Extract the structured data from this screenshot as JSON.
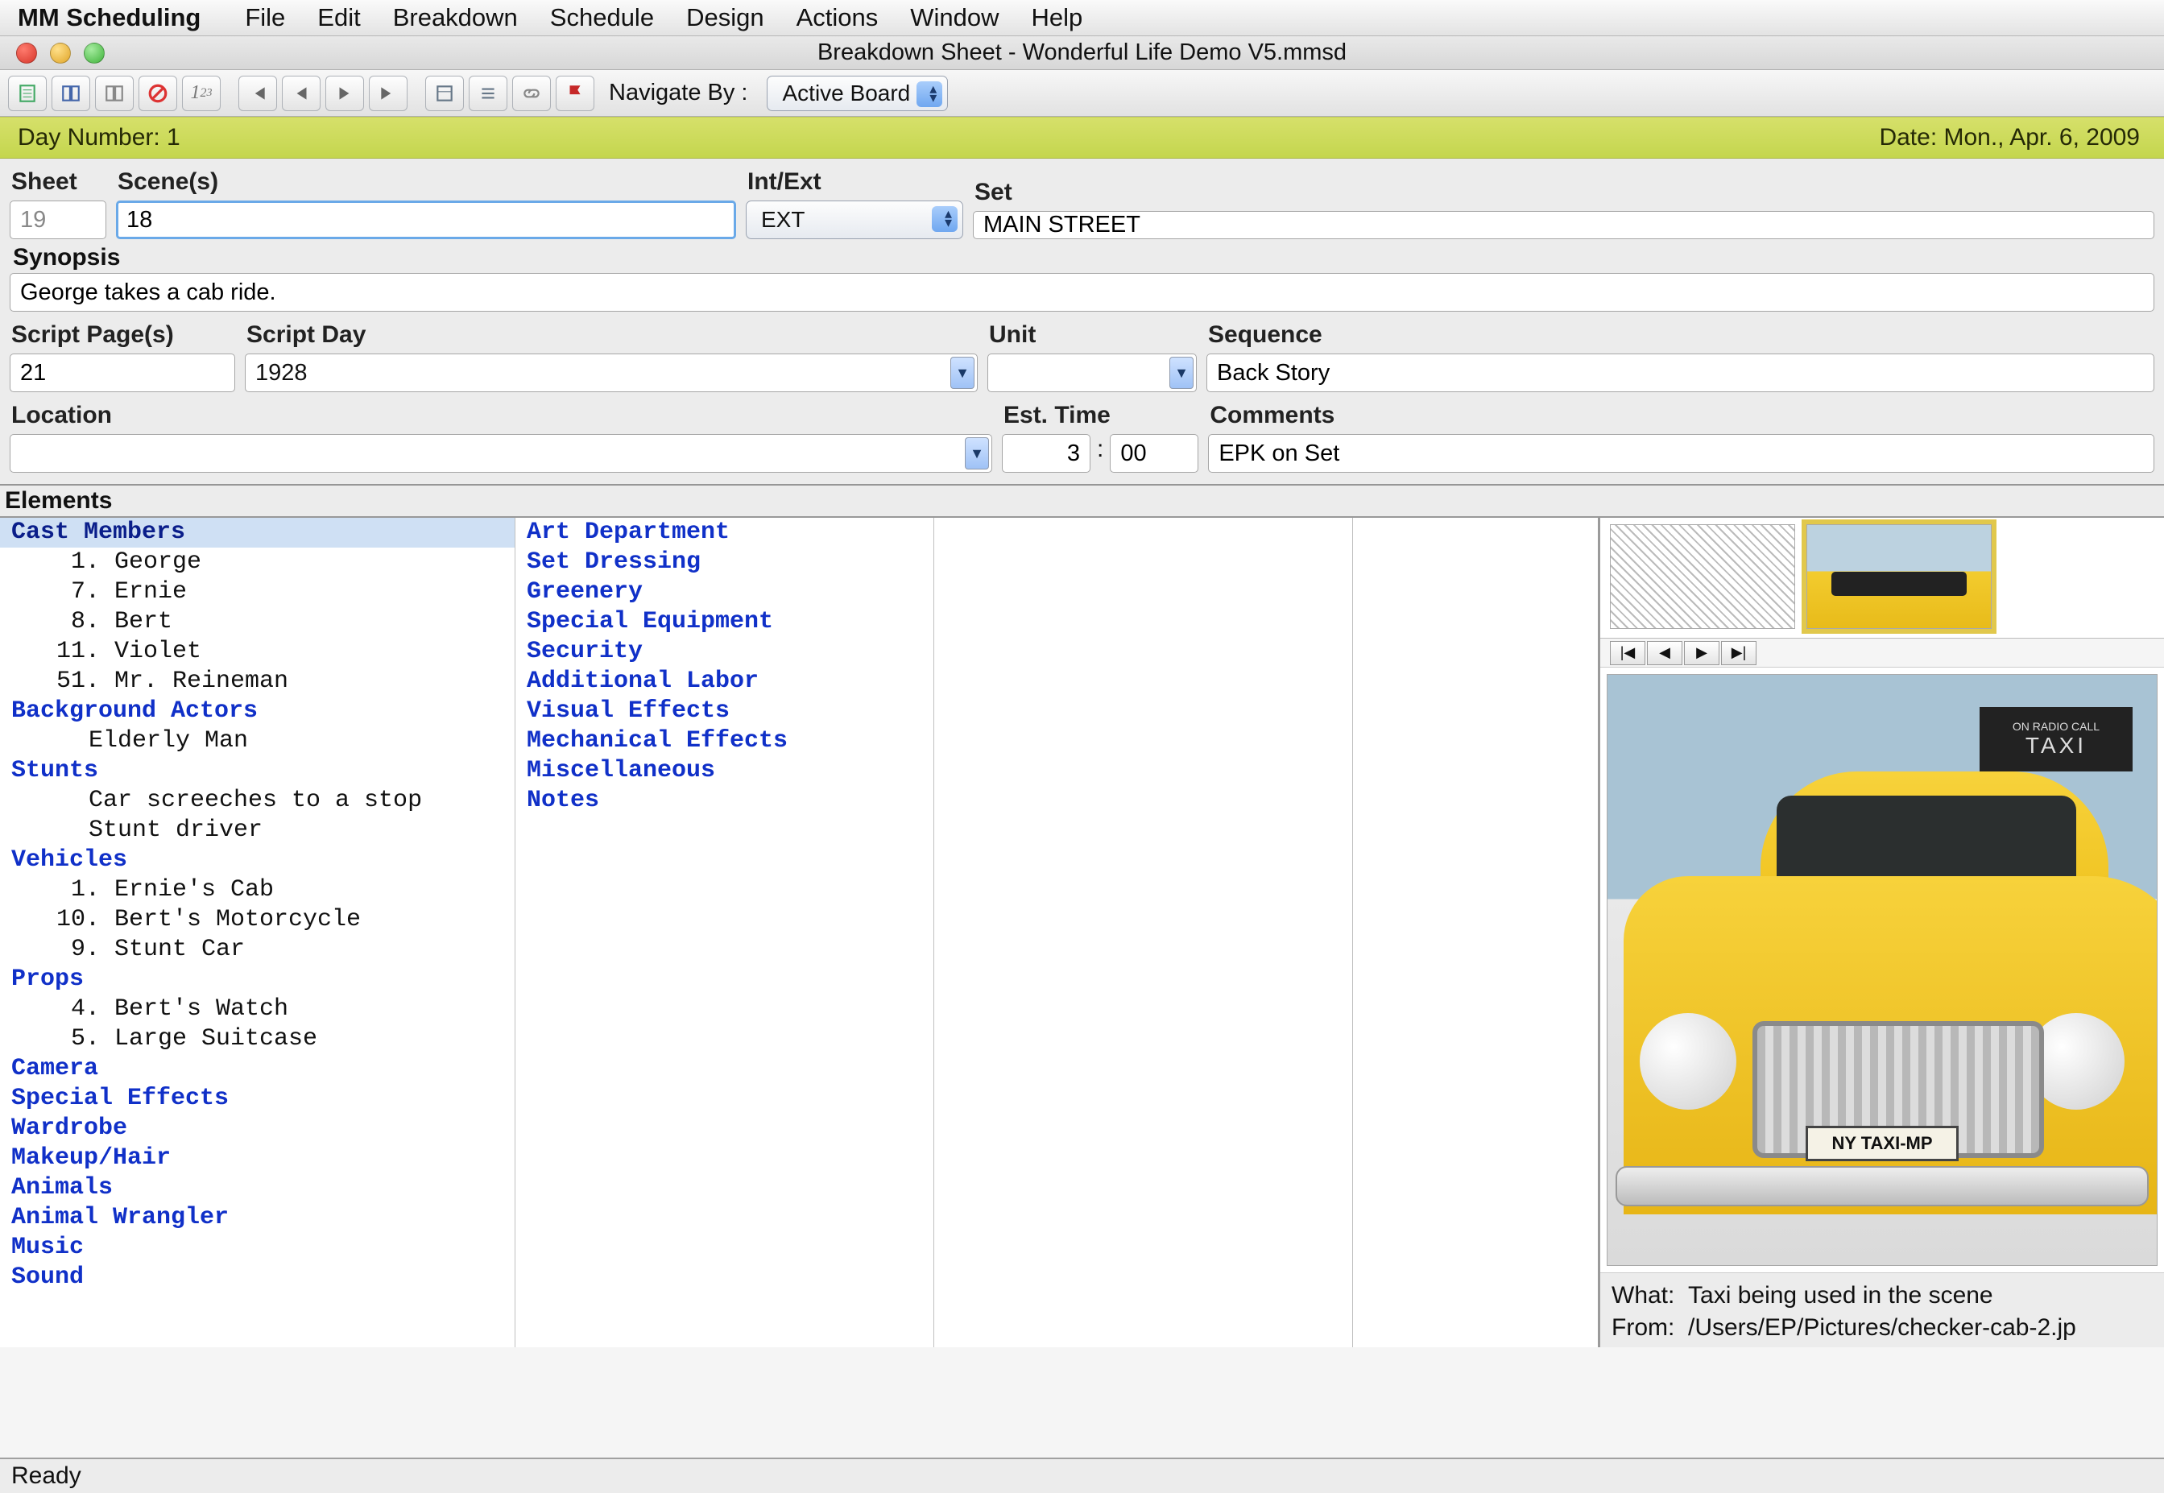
{
  "menubar": {
    "app": "MM Scheduling",
    "items": [
      "File",
      "Edit",
      "Breakdown",
      "Schedule",
      "Design",
      "Actions",
      "Window",
      "Help"
    ]
  },
  "window": {
    "title": "Breakdown Sheet - Wonderful Life Demo V5.mmsd"
  },
  "toolbar": {
    "navigate_label": "Navigate By :",
    "navigate_value": "Active Board"
  },
  "daystrip": {
    "day_label": "Day Number: 1",
    "date_label": "Date: Mon., Apr. 6, 2009"
  },
  "form": {
    "labels": {
      "sheet": "Sheet",
      "scenes": "Scene(s)",
      "intext": "Int/Ext",
      "set": "Set",
      "synopsis": "Synopsis",
      "pages": "Script Page(s)",
      "sday": "Script Day",
      "unit": "Unit",
      "sequence": "Sequence",
      "location": "Location",
      "esttime": "Est. Time",
      "comments": "Comments"
    },
    "sheet": "19",
    "scenes": "18",
    "intext": "EXT",
    "set": "MAIN STREET",
    "synopsis": "George takes a cab ride.",
    "pages": "21",
    "script_day": "1928",
    "unit": "",
    "sequence": "Back Story",
    "location": "",
    "est_h": "3",
    "est_m": "00",
    "comments": "EPK on Set"
  },
  "elements_label": "Elements",
  "elements": {
    "col1": [
      {
        "t": "cat",
        "sel": true,
        "v": "Cast Members"
      },
      {
        "t": "num",
        "v": " 1. George"
      },
      {
        "t": "num",
        "v": " 7. Ernie"
      },
      {
        "t": "num",
        "v": " 8. Bert"
      },
      {
        "t": "num",
        "v": "11. Violet"
      },
      {
        "t": "num",
        "v": "51. Mr. Reineman"
      },
      {
        "t": "cat",
        "v": "Background Actors"
      },
      {
        "t": "item",
        "v": "Elderly Man"
      },
      {
        "t": "cat",
        "v": "Stunts"
      },
      {
        "t": "item",
        "v": "Car screeches to a stop"
      },
      {
        "t": "item",
        "v": "Stunt driver"
      },
      {
        "t": "cat",
        "v": "Vehicles"
      },
      {
        "t": "num",
        "v": " 1. Ernie's Cab"
      },
      {
        "t": "num",
        "v": "10. Bert's Motorcycle"
      },
      {
        "t": "num",
        "v": " 9. Stunt Car"
      },
      {
        "t": "cat",
        "v": "Props"
      },
      {
        "t": "num",
        "v": " 4. Bert's Watch"
      },
      {
        "t": "num",
        "v": " 5. Large Suitcase"
      },
      {
        "t": "cat",
        "v": "Camera"
      },
      {
        "t": "cat",
        "v": "Special Effects"
      },
      {
        "t": "cat",
        "v": "Wardrobe"
      },
      {
        "t": "cat",
        "v": "Makeup/Hair"
      },
      {
        "t": "cat",
        "v": "Animals"
      },
      {
        "t": "cat",
        "v": "Animal Wrangler"
      },
      {
        "t": "cat",
        "v": "Music"
      },
      {
        "t": "cat",
        "v": "Sound"
      }
    ],
    "col2": [
      {
        "t": "cat",
        "v": "Art Department"
      },
      {
        "t": "cat",
        "v": "Set Dressing"
      },
      {
        "t": "cat",
        "v": "Greenery"
      },
      {
        "t": "cat",
        "v": "Special Equipment"
      },
      {
        "t": "cat",
        "v": "Security"
      },
      {
        "t": "cat",
        "v": "Additional Labor"
      },
      {
        "t": "cat",
        "v": "Visual Effects"
      },
      {
        "t": "cat",
        "v": "Mechanical Effects"
      },
      {
        "t": "cat",
        "v": "Miscellaneous"
      },
      {
        "t": "cat",
        "v": "Notes"
      }
    ]
  },
  "side": {
    "plate": "NY TAXI-MP",
    "sign_top": "ON RADIO CALL",
    "sign_main": "TAXI",
    "what_label": "What:",
    "what": "Taxi being used in the scene",
    "from_label": "From:",
    "from": "/Users/EP/Pictures/checker-cab-2.jp"
  },
  "status": "Ready"
}
